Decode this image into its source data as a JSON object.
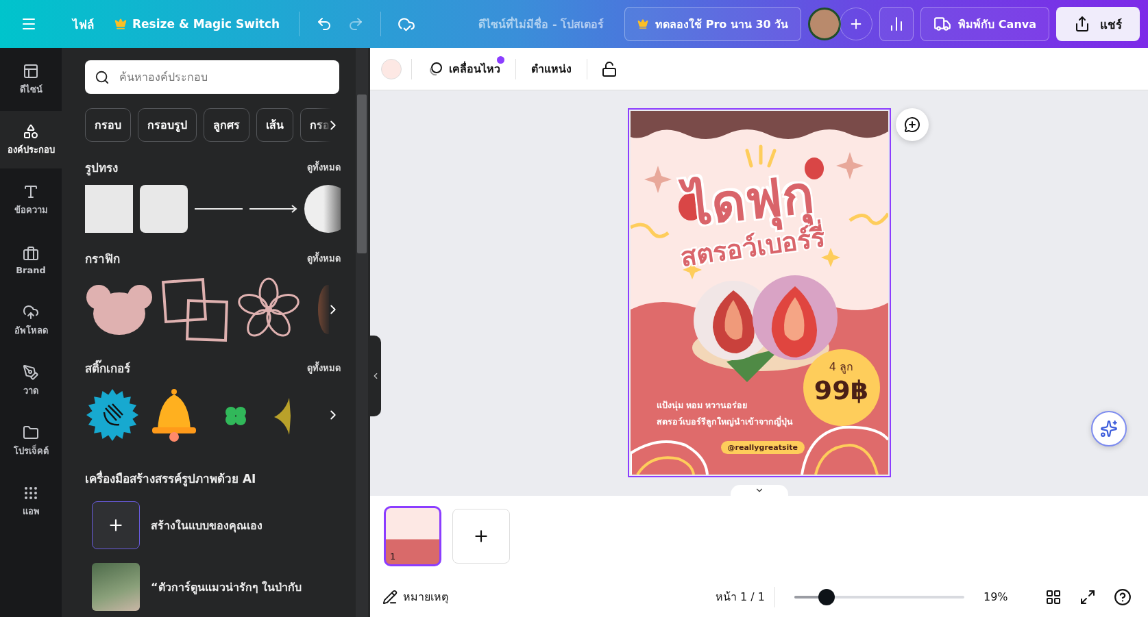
{
  "topbar": {
    "file": "ไฟล์",
    "resize": "Resize & Magic Switch",
    "title": "ดีไซน์ที่ไม่มีชื่อ - โปสเตอร์",
    "trial": "ทดลองใช้ Pro นาน 30 วัน",
    "print": "พิมพ์กับ Canva",
    "share": "แชร์"
  },
  "rail": {
    "items": [
      {
        "kind": "design",
        "label": "ดีไซน์",
        "selected": false
      },
      {
        "kind": "elements",
        "label": "องค์ประกอบ",
        "selected": true
      },
      {
        "kind": "text",
        "label": "ข้อความ",
        "selected": false
      },
      {
        "kind": "brand",
        "label": "Brand",
        "selected": false
      },
      {
        "kind": "uploads",
        "label": "อัพโหลด",
        "selected": false
      },
      {
        "kind": "draw",
        "label": "วาด",
        "selected": false
      },
      {
        "kind": "projects",
        "label": "โปรเจ็คต์",
        "selected": false
      },
      {
        "kind": "apps",
        "label": "แอพ",
        "selected": false
      }
    ]
  },
  "panel": {
    "search": {
      "placeholder": "ค้นหาองค์ประกอบ"
    },
    "chips": [
      "กรอบ",
      "กรอบรูป",
      "ลูกศร",
      "เส้น",
      "กรอ"
    ],
    "sections": [
      {
        "kind": "shapes",
        "title": "รูปทรง",
        "see_all": "ดูทั้งหมด"
      },
      {
        "kind": "graphics",
        "title": "กราฟิก",
        "see_all": "ดูทั้งหมด"
      },
      {
        "kind": "stickers",
        "title": "สติ๊กเกอร์",
        "see_all": "ดูทั้งหมด"
      }
    ],
    "ai": {
      "title": "เครื่องมือสร้างสรรค์รูปภาพด้วย AI",
      "items": [
        {
          "kind": "create",
          "label": "สร้างในแบบของคุณเอง"
        },
        {
          "kind": "example",
          "label": "“ตัวการ์ตูนแมวน่ารักๆ ในป่ากับ"
        }
      ]
    }
  },
  "toolbar": {
    "color": "#fde8e4",
    "animate": "เคลื่อนไหว",
    "animate_badge": true,
    "position": "ตำแหน่ง"
  },
  "poster": {
    "title": "ไดฟุกุ",
    "subtitle": "สตรอว์เบอร์รี่",
    "quantity": "4 ลูก",
    "price": "99฿",
    "lines": [
      "แป้งนุ่ม หอม หวานอร่อย",
      "สตรอว์เบอร์รีลูกใหญ่นำเข้าจากญี่ปุ่น"
    ],
    "site": "@reallygreatsite"
  },
  "pages": [
    {
      "number": "1",
      "selected": true
    }
  ],
  "footer": {
    "notes": "หมายเหตุ",
    "page": "หน้า 1 / 1",
    "zoom": {
      "level": 0.19,
      "reading": "19%"
    }
  }
}
